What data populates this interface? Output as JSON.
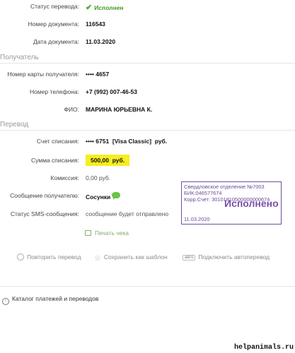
{
  "status": {
    "label": "Статус перевода:",
    "value": "Исполнен"
  },
  "document": {
    "number_label": "Номер документа:",
    "number_value": "116543",
    "date_label": "Дата документа:",
    "date_value": "11.03.2020"
  },
  "recipient": {
    "section_title": "Получатель",
    "card_label": "Номер карты получателя:",
    "card_value": "•••• 4657",
    "phone_label": "Номер телефона:",
    "phone_value": "+7 (992) 007-46-53",
    "name_label": "ФИО:",
    "name_value": "МАРИНА ЮРЬЕВНА К."
  },
  "transfer": {
    "section_title": "Перевод",
    "account_label": "Счет списания:",
    "account_value": "•••• 6751  [Visa Classic]  руб.",
    "amount_label": "Сумма списания:",
    "amount_value": "500,00  руб.",
    "commission_label": "Комиссия:",
    "commission_value": "0,00 руб.",
    "message_label": "Сообщение получателю:",
    "message_value": "Сосунки",
    "sms_label": "Статус SMS-сообщения:",
    "sms_value": "сообщение будет отправлено"
  },
  "stamp": {
    "line1": "Свердловское отделение №7003",
    "line2": "БИК:046577674",
    "line3": "Корр.Счет: 30101810500000000674",
    "big": "Исполнено",
    "date": "11.03.2020"
  },
  "actions": {
    "print": "Печать чека",
    "repeat": "Повторить перевод",
    "save_template": "Сохранить как шаблон",
    "auto_badge": "авто",
    "autopay": "Подключить автоперевод"
  },
  "catalog": "Каталог платежей и переводов",
  "watermark": "helpanimals.ru",
  "colors": {
    "accent_green": "#3f9e1f",
    "highlight": "#f6ee1f",
    "stamp": "#6f4f9e"
  }
}
